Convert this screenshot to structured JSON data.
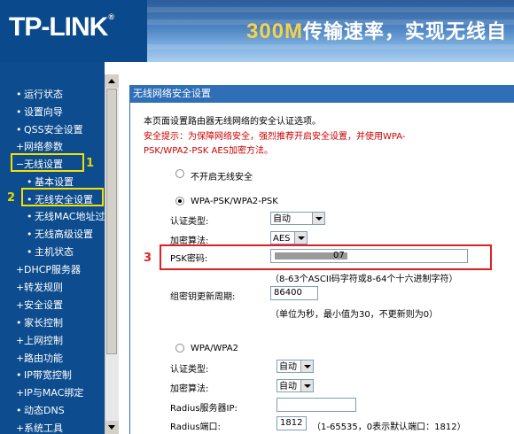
{
  "header": {
    "logo": "TP-LINK",
    "logo_mark": "®",
    "slogan_num": "300M",
    "slogan_text": "传输速率，实现无线自"
  },
  "sidebar": {
    "items": [
      {
        "label": "运行状态",
        "marker": "•"
      },
      {
        "label": "设置向导",
        "marker": "•"
      },
      {
        "label": "QSS安全设置",
        "marker": "•"
      },
      {
        "label": "网络参数",
        "marker": "+"
      },
      {
        "label": "无线设置",
        "marker": "−"
      },
      {
        "label": "基本设置",
        "marker": "•"
      },
      {
        "label": "无线安全设置",
        "marker": "•"
      },
      {
        "label": "无线MAC地址过滤",
        "marker": "•"
      },
      {
        "label": "无线高级设置",
        "marker": "•"
      },
      {
        "label": "主机状态",
        "marker": "•"
      },
      {
        "label": "DHCP服务器",
        "marker": "+"
      },
      {
        "label": "转发规则",
        "marker": "+"
      },
      {
        "label": "安全设置",
        "marker": "+"
      },
      {
        "label": "家长控制",
        "marker": "•"
      },
      {
        "label": "上网控制",
        "marker": "+"
      },
      {
        "label": "路由功能",
        "marker": "+"
      },
      {
        "label": "IP带宽控制",
        "marker": "•"
      },
      {
        "label": "IP与MAC绑定",
        "marker": "+"
      },
      {
        "label": "动态DNS",
        "marker": "•"
      },
      {
        "label": "系统工具",
        "marker": "+"
      }
    ]
  },
  "annotations": {
    "n1": "1",
    "n2": "2",
    "n3": "3"
  },
  "panel": {
    "title": "无线网络安全设置",
    "intro": "本页面设置路由器无线网络的安全认证选项。",
    "tip_line1": "安全提示：为保障网络安全，强烈推荐开启安全设置，并使用WPA-",
    "tip_line2": "PSK/WPA2-PSK AES加密方法。",
    "opt_none": "不开启无线安全",
    "opt_wpapsk": "WPA-PSK/WPA2-PSK",
    "auth_label": "认证类型:",
    "auth_value": "自动",
    "enc_label": "加密算法:",
    "enc_value": "AES",
    "psk_label": "PSK密码:",
    "psk_value": "07",
    "psk_hint": "（8-63个ASCII码字符或8-64个十六进制字符）",
    "renew_label": "组密钥更新周期:",
    "renew_value": "86400",
    "renew_hint": "（单位为秒，最小值为30，不更新则为0）",
    "opt_wpa": "WPA/WPA2",
    "auth2_label": "认证类型:",
    "auth2_value": "自动",
    "enc2_label": "加密算法:",
    "enc2_value": "自动",
    "radius_ip_label": "Radius服务器IP:",
    "radius_ip_value": "",
    "radius_port_label": "Radius端口:",
    "radius_port_value": "1812",
    "radius_port_hint": "（1-65535，0表示默认端口：1812）"
  }
}
